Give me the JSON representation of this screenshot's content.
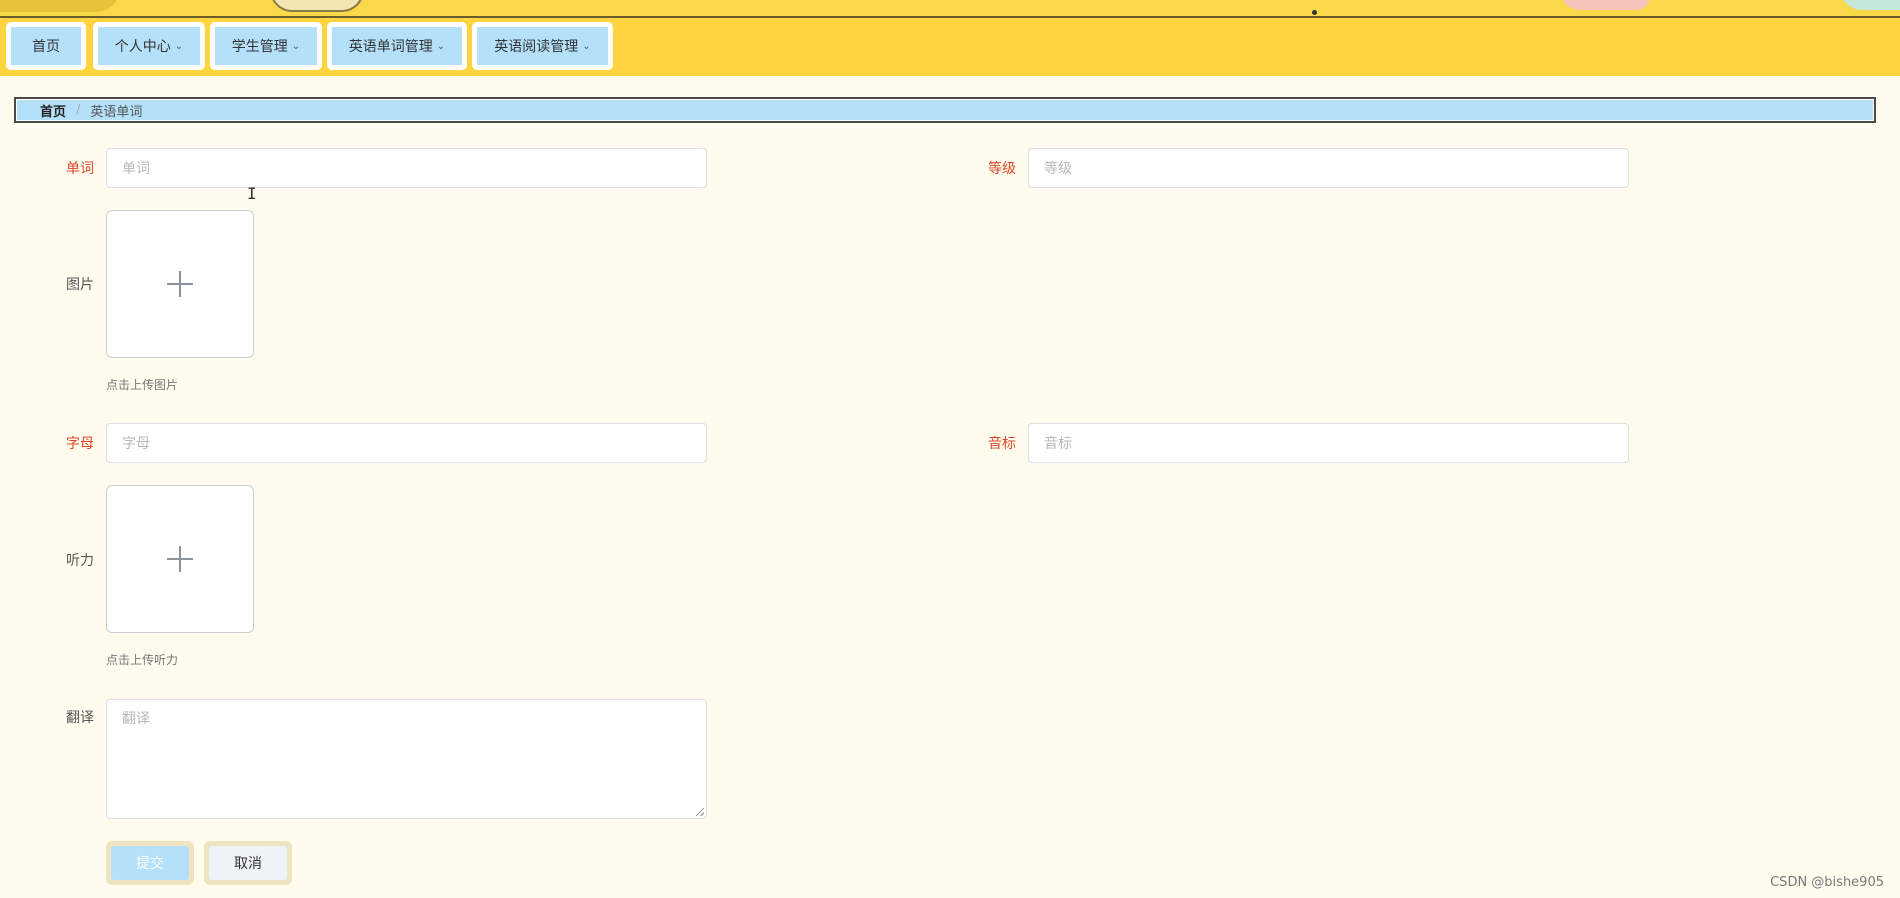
{
  "nav": {
    "items": [
      {
        "label": "首页",
        "dropdown": false
      },
      {
        "label": "个人中心",
        "dropdown": true
      },
      {
        "label": "学生管理",
        "dropdown": true
      },
      {
        "label": "英语单词管理",
        "dropdown": true
      },
      {
        "label": "英语阅读管理",
        "dropdown": true
      }
    ]
  },
  "breadcrumb": {
    "home": "首页",
    "separator": "/",
    "current": "英语单词"
  },
  "form": {
    "word": {
      "label": "单词",
      "placeholder": "单词",
      "value": ""
    },
    "level": {
      "label": "等级",
      "placeholder": "等级",
      "value": ""
    },
    "image": {
      "label": "图片",
      "tip": "点击上传图片"
    },
    "letter": {
      "label": "字母",
      "placeholder": "字母",
      "value": ""
    },
    "phonetic": {
      "label": "音标",
      "placeholder": "音标",
      "value": ""
    },
    "audio": {
      "label": "听力",
      "tip": "点击上传听力"
    },
    "translation": {
      "label": "翻译",
      "placeholder": "翻译",
      "value": ""
    }
  },
  "buttons": {
    "submit": "提交",
    "cancel": "取消"
  },
  "watermark": "CSDN @bishe905",
  "colors": {
    "navbar": "#ffd43f",
    "accent_blue": "#b4e0fa",
    "required": "#d9482b",
    "page_bg": "#fffcee"
  }
}
